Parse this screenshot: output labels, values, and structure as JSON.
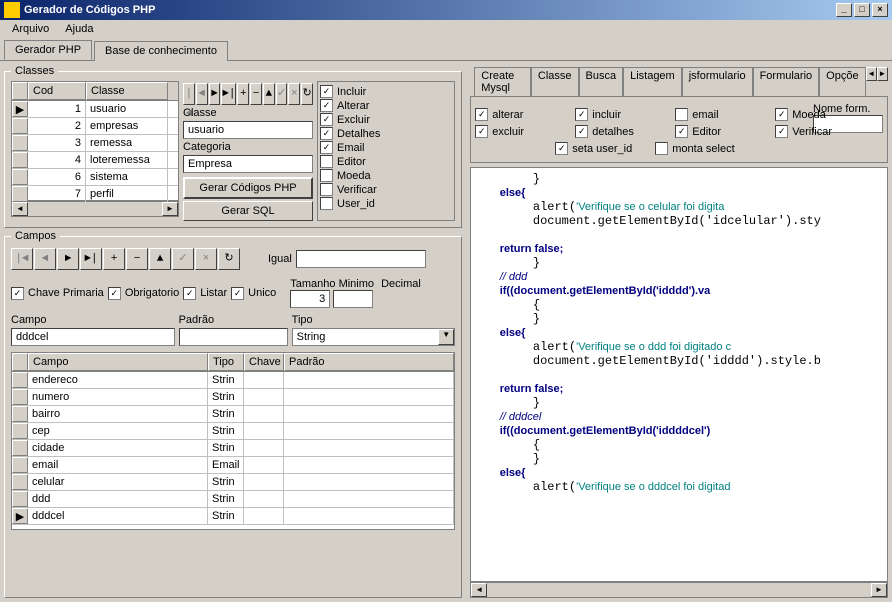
{
  "title": "Gerador de Códigos PHP",
  "menu": [
    "Arquivo",
    "Ajuda"
  ],
  "top_tabs": [
    "Gerador PHP",
    "Base de conhecimento"
  ],
  "top_tab_active": 0,
  "classes": {
    "legend": "Classes",
    "cols": [
      "Cod",
      "Classe"
    ],
    "rows": [
      {
        "cod": "1",
        "classe": "usuario"
      },
      {
        "cod": "2",
        "classe": "empresas"
      },
      {
        "cod": "3",
        "classe": "remessa"
      },
      {
        "cod": "4",
        "classe": "loteremessa"
      },
      {
        "cod": "6",
        "classe": "sistema"
      },
      {
        "cod": "7",
        "classe": "perfil"
      }
    ],
    "label_classe": "Classe",
    "value_classe": "usuario",
    "label_categoria": "Categoria",
    "value_categoria": "Empresa",
    "btn_gerar_php": "Gerar Códigos PHP",
    "btn_gerar_sql": "Gerar SQL",
    "checks": [
      {
        "label": "Incluir",
        "checked": true
      },
      {
        "label": "Alterar",
        "checked": true
      },
      {
        "label": "Excluir",
        "checked": true
      },
      {
        "label": "Detalhes",
        "checked": true
      },
      {
        "label": "Email",
        "checked": true
      },
      {
        "label": "Editor",
        "checked": false
      },
      {
        "label": "Moeda",
        "checked": false
      },
      {
        "label": "Verificar",
        "checked": false
      },
      {
        "label": "User_id",
        "checked": false
      }
    ]
  },
  "campos": {
    "legend": "Campos",
    "label_igual": "Igual",
    "chave_primaria": "Chave Primaria",
    "obrigatorio": "Obrigatorio",
    "listar": "Listar",
    "unico": "Unico",
    "label_tamanho": "Tamanho Minimo",
    "value_tamanho": "3",
    "label_decimal": "Decimal",
    "label_campo": "Campo",
    "value_campo": "dddcel",
    "label_padrao": "Padrão",
    "value_padrao": "",
    "label_tipo": "Tipo",
    "value_tipo": "String",
    "cols": [
      "Campo",
      "Tipo",
      "Chave",
      "Padrão"
    ],
    "rows": [
      {
        "campo": "endereco",
        "tipo": "String",
        "chave": "",
        "padrao": ""
      },
      {
        "campo": "numero",
        "tipo": "String",
        "chave": "",
        "padrao": ""
      },
      {
        "campo": "bairro",
        "tipo": "String",
        "chave": "",
        "padrao": ""
      },
      {
        "campo": "cep",
        "tipo": "String",
        "chave": "",
        "padrao": ""
      },
      {
        "campo": "cidade",
        "tipo": "String",
        "chave": "",
        "padrao": ""
      },
      {
        "campo": "email",
        "tipo": "Email",
        "chave": "",
        "padrao": ""
      },
      {
        "campo": "celular",
        "tipo": "String",
        "chave": "",
        "padrao": ""
      },
      {
        "campo": "ddd",
        "tipo": "String",
        "chave": "",
        "padrao": ""
      },
      {
        "campo": "dddcel",
        "tipo": "String",
        "chave": "",
        "padrao": ""
      }
    ]
  },
  "right_tabs": [
    "Create Mysql",
    "Classe",
    "Busca",
    "Listagem",
    "jsformulario",
    "Formulario",
    "Opçõe"
  ],
  "right_tab_active": 5,
  "form_opts": {
    "nome_form": "Nome form.",
    "r1": [
      {
        "label": "alterar",
        "checked": true
      },
      {
        "label": "incluir",
        "checked": true
      },
      {
        "label": "email",
        "checked": false
      },
      {
        "label": "Moeda",
        "checked": true
      }
    ],
    "r2": [
      {
        "label": "excluir",
        "checked": true
      },
      {
        "label": "detalhes",
        "checked": true
      },
      {
        "label": "Editor",
        "checked": true
      },
      {
        "label": "Verificar",
        "checked": true
      }
    ],
    "r3": [
      {
        "label": "seta user_id",
        "checked": true
      },
      {
        "label": "monta select",
        "checked": false
      }
    ]
  },
  "code_lines": [
    {
      "t": "        }",
      "c": ""
    },
    {
      "t": "        else{",
      "c": "kw"
    },
    {
      "t": "        alert('Verifique se o celular foi digita",
      "c": "str"
    },
    {
      "t": "        document.getElementById('idcelular').sty",
      "c": ""
    },
    {
      "t": "",
      "c": ""
    },
    {
      "t": "        return false;",
      "c": "kw"
    },
    {
      "t": "        }",
      "c": ""
    },
    {
      "t": "        // ddd",
      "c": "cm"
    },
    {
      "t": "        if((document.getElementById('idddd').va",
      "c": "kw"
    },
    {
      "t": "        {",
      "c": ""
    },
    {
      "t": "        }",
      "c": ""
    },
    {
      "t": "        else{",
      "c": "kw"
    },
    {
      "t": "        alert('Verifique se o ddd foi digitado c",
      "c": "str"
    },
    {
      "t": "        document.getElementById('idddd').style.b",
      "c": ""
    },
    {
      "t": "",
      "c": ""
    },
    {
      "t": "        return false;",
      "c": "kw"
    },
    {
      "t": "        }",
      "c": ""
    },
    {
      "t": "        // dddcel",
      "c": "cm"
    },
    {
      "t": "        if((document.getElementById('iddddcel')",
      "c": "kw"
    },
    {
      "t": "        {",
      "c": ""
    },
    {
      "t": "        }",
      "c": ""
    },
    {
      "t": "        else{",
      "c": "kw"
    },
    {
      "t": "        alert('Verifique se o dddcel foi digitad",
      "c": "str"
    }
  ]
}
